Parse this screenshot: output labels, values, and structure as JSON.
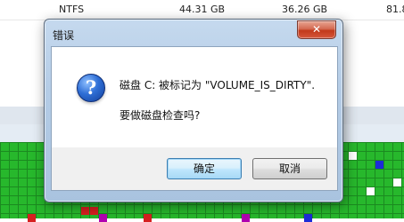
{
  "background": {
    "volume_row": {
      "filesystem": "NTFS",
      "capacity": "44.31 GB",
      "free_space": "36.26 GB",
      "percent_free": "81.8"
    }
  },
  "dialog": {
    "title": "错误",
    "close_glyph": "✕",
    "icon": "question-icon",
    "icon_glyph": "?",
    "message_line1": "磁盘 C: 被标记为 \"VOLUME_IS_DIRTY\".",
    "message_line2": "要做磁盘检查吗?",
    "ok_label": "确定",
    "cancel_label": "取消"
  }
}
